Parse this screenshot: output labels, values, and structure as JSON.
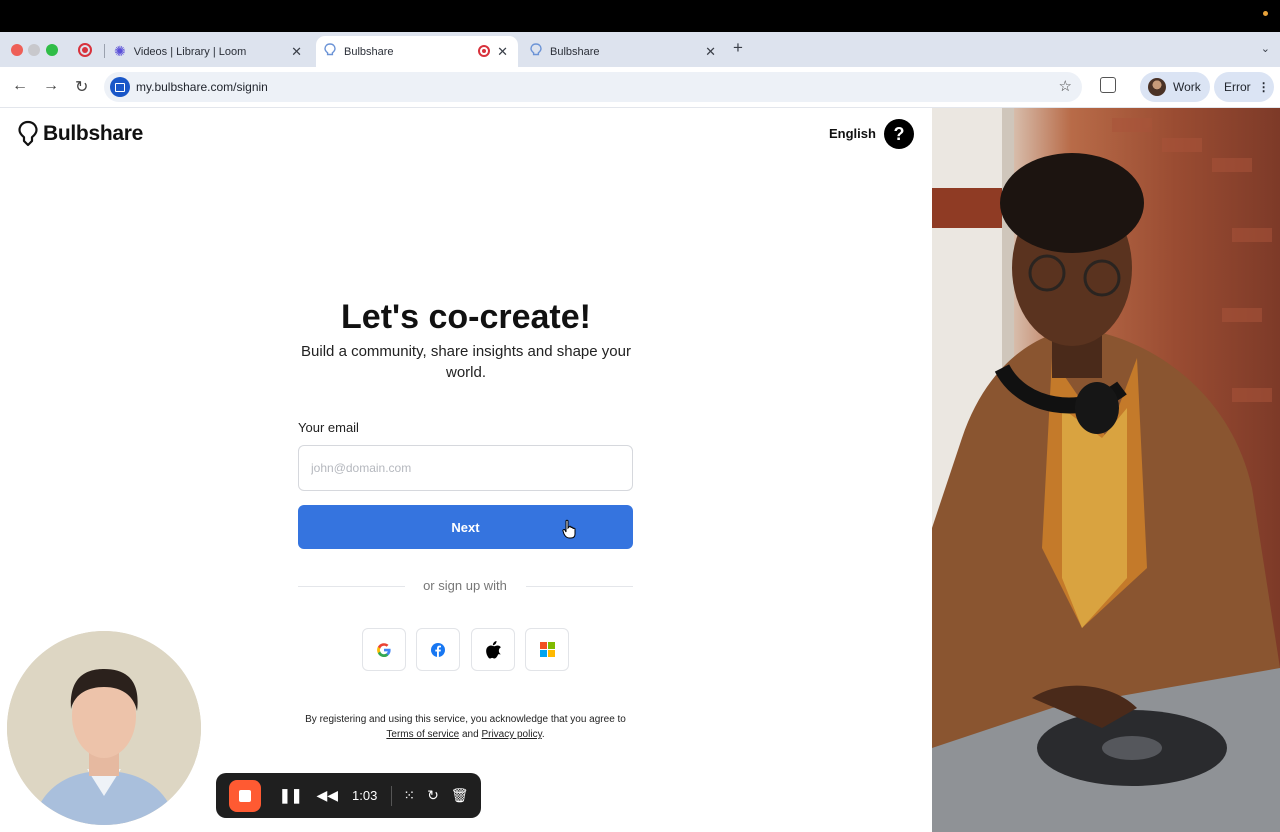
{
  "browser": {
    "tabs": [
      {
        "title": "Videos | Library | Loom",
        "icon": "loom-icon"
      },
      {
        "title": "Bulbshare",
        "icon": "bulb-icon",
        "active": true,
        "recording": true
      },
      {
        "title": "Bulbshare",
        "icon": "bulb-icon"
      }
    ],
    "url": "my.bulbshare.com/signin",
    "profile_label": "Work",
    "error_label": "Error"
  },
  "header": {
    "logo_text": "Bulbshare",
    "language": "English",
    "help_symbol": "?"
  },
  "signin": {
    "heading": "Let's co-create!",
    "subheading": "Build a community, share insights and shape your world.",
    "email_label": "Your email",
    "email_placeholder": "john@domain.com",
    "email_value": "",
    "next_label": "Next",
    "divider_text": "or sign up with",
    "social_providers": [
      "google-icon",
      "facebook-icon",
      "apple-icon",
      "microsoft-icon"
    ],
    "legal_prefix": "By registering and using this service, you acknowledge that you agree to ",
    "terms_link": "Terms of service",
    "legal_and": " and ",
    "privacy_link": "Privacy policy",
    "legal_suffix": "."
  },
  "recorder": {
    "elapsed": "1:03"
  },
  "colors": {
    "primary_button": "#3574df",
    "record_button": "#ff5a32",
    "tab_strip": "#dde3ee"
  }
}
